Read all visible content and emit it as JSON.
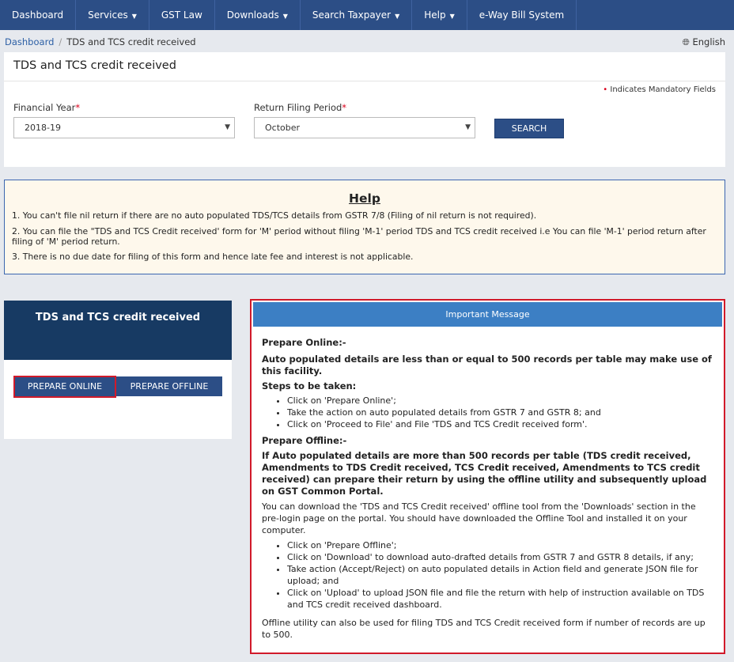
{
  "nav": {
    "items": [
      {
        "label": "Dashboard",
        "caret": false
      },
      {
        "label": "Services",
        "caret": true
      },
      {
        "label": "GST Law",
        "caret": false
      },
      {
        "label": "Downloads",
        "caret": true
      },
      {
        "label": "Search Taxpayer",
        "caret": true
      },
      {
        "label": "Help",
        "caret": true
      },
      {
        "label": "e-Way Bill System",
        "caret": false
      }
    ]
  },
  "breadcrumb": {
    "home": "Dashboard",
    "current": "TDS and TCS credit received"
  },
  "language": "English",
  "form": {
    "title": "TDS and TCS credit received",
    "mandatory_note": "Indicates Mandatory Fields",
    "financial_year_label": "Financial Year",
    "financial_year_value": "2018-19",
    "period_label": "Return Filing Period",
    "period_value": "October",
    "search_label": "SEARCH"
  },
  "help": {
    "title": "Help",
    "items": [
      "1. You can't file nil return if there are no auto populated TDS/TCS details from GSTR 7/8 (Filing of nil return is not required).",
      "2. You can file the \"TDS and TCS Credit received' form for 'M' period without filing 'M-1' period TDS and TCS credit received i.e You can file 'M-1' period return after filing of 'M' period return.",
      "3. There is no due date for filing of this form and hence late fee and interest is not applicable."
    ]
  },
  "left_card": {
    "title": "TDS and TCS credit received",
    "prepare_online": "PREPARE ONLINE",
    "prepare_offline": "PREPARE OFFLINE"
  },
  "important": {
    "header": "Important Message",
    "online_heading": "Prepare Online:-",
    "online_bold": "Auto populated details are less than or equal to 500 records per table may make use of this facility.",
    "steps_heading": "Steps to be taken:",
    "online_steps": [
      "Click on 'Prepare Online';",
      "Take the action on auto populated details from GSTR 7 and GSTR 8; and",
      "Click on 'Proceed to File' and File 'TDS and TCS Credit received form'."
    ],
    "offline_heading": "Prepare Offline:-",
    "offline_bold": "If Auto populated details are more than 500 records per table (TDS credit received, Amendments to TDS Credit received, TCS Credit received, Amendments to TCS credit received) can prepare their return by using the offline utility and subsequently upload on GST Common Portal.",
    "offline_text": "You can download the 'TDS and TCS Credit received' offline tool from the 'Downloads' section in the pre-login page on the portal. You should have downloaded the Offline Tool and installed it on your computer.",
    "offline_steps": [
      "Click on 'Prepare Offline';",
      "Click on 'Download' to download auto-drafted details from GSTR 7 and GSTR 8 details, if any;",
      "Take action (Accept/Reject) on auto populated details in Action field and generate JSON file for upload; and",
      "Click on 'Upload' to upload JSON file and file the return with help of instruction available on TDS and TCS credit received dashboard."
    ],
    "footer": "Offline utility can also be used for filing TDS and TCS Credit received form if number of records are up to 500."
  }
}
